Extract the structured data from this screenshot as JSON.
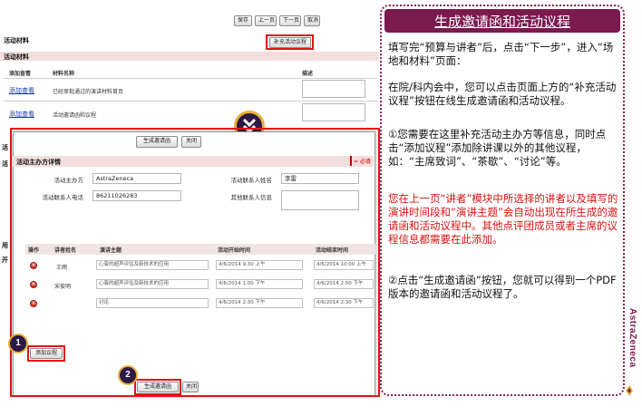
{
  "toolbar": {
    "save": "保存",
    "prev": "上一页",
    "next": "下一页",
    "cancel": "取消"
  },
  "materials": {
    "section_title": "活动材料",
    "sub_title": "活动材料",
    "add_agenda_btn": "补充活动议程",
    "headers": {
      "add_view": "添加查看",
      "name": "材料名称",
      "desc": "描述"
    },
    "rows": [
      {
        "action": "添加查看",
        "name": "已经审批通过的演讲材料首页"
      },
      {
        "action": "添加查看",
        "name": "活动邀请函和议程"
      }
    ]
  },
  "side_fragments": {
    "frag1": "活",
    "frag2": "活",
    "frag3": "用",
    "frag4": "开"
  },
  "dialog": {
    "generate_btn": "生成邀请函",
    "close_btn": "关闭",
    "title": "活动主办方详情",
    "required_hint": "= 必填",
    "fields": {
      "sponsor_label": "活动主办方",
      "sponsor_value": "AstraZeneca",
      "contact_name_label": "活动联系人姓名",
      "contact_name_value": "李雷",
      "contact_phone_label": "活动联系人电话",
      "contact_phone_value": "86211026283",
      "other_contact_label": "其他联系人信息",
      "other_contact_value": ""
    },
    "grid_headers": {
      "op": "操作",
      "speaker": "讲者姓名",
      "topic": "演讲主题",
      "start": "活动开始时间",
      "end": "活动结束时间"
    },
    "rows": [
      {
        "speaker": "王雨",
        "topic": "心衰的超声评估及新技术的应用",
        "start": "4/6/2014 9:30 上午",
        "end": "4/6/2014 10:00 上午"
      },
      {
        "speaker": "宋俊明",
        "topic": "心衰的超声评估及新技术的应用",
        "start": "4/6/2014 1:00 下午",
        "end": "4/6/2014 2:00 下午"
      },
      {
        "speaker": "",
        "topic": "讨论",
        "start": "4/6/2014 2:30 下午",
        "end": "4/6/2014 2:30 下午"
      }
    ],
    "add_agenda_btn": "添加议程",
    "generate_btn_bottom": "生成邀请函",
    "close_btn_bottom": "关闭"
  },
  "badges": {
    "one": "1",
    "two": "2"
  },
  "panel": {
    "title": "生成邀请函和活动议程",
    "p1": "填写完“预算与讲者”后，点击“下一步”，进入“场地和材料”页面：",
    "p2": "在院/科内会中，您可以点击页面上方的“补充活动议程”按钮在线生成邀请函和活动议程。",
    "p3": "①您需要在这里补充活动主办方等信息，同时点击“添加议程”添加除讲课以外的其他议程，如：“主席致词”、“茶歇”、“讨论”等。",
    "p4": "您在上一页“讲者”模块中所选择的讲者以及填写的演讲时间段和“演讲主题”会自动出现在所生成的邀请函和活动议程中。其他点评团成员或者主席的议程信息都需要在此添加。",
    "p5": "②点击“生成邀请函”按钮，您就可以得到一个PDF版本的邀请函和活动议程了。"
  },
  "brand": "AstraZeneca",
  "colors": {
    "accent": "#7a1a4e",
    "highlight": "#e01515",
    "badge_ring": "#e6b23a",
    "badge_bg": "#2d1a44"
  }
}
